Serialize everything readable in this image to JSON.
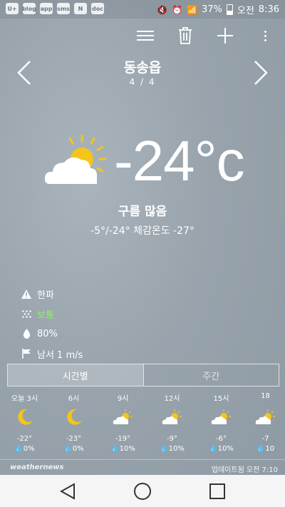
{
  "status_bar": {
    "battery": "37%",
    "ampm": "오전",
    "time": "8:36",
    "left_icons": [
      "U+",
      "blog",
      "app",
      "sms",
      "N",
      "doc"
    ]
  },
  "toolbar": {
    "icons": [
      "menu-icon",
      "trash-icon",
      "add-icon",
      "more-icon"
    ]
  },
  "location": {
    "name": "동송읍",
    "page": "4 / 4"
  },
  "current": {
    "temperature": "-24°c",
    "condition": "구름 많음",
    "range": "-5°/-24° 체감온도 -27°"
  },
  "details": {
    "warning": "한파",
    "air_quality": "보통",
    "humidity": "80%",
    "wind": "남서 1 m/s"
  },
  "tabs": {
    "hourly": "시간별",
    "weekly": "주간"
  },
  "hourly": [
    {
      "time": "오늘 3시",
      "icon": "moon",
      "temp": "-22°",
      "rain": "0%"
    },
    {
      "time": "6시",
      "icon": "moon",
      "temp": "-23°",
      "rain": "0%"
    },
    {
      "time": "9시",
      "icon": "sun-cloud",
      "temp": "-19°",
      "rain": "10%"
    },
    {
      "time": "12시",
      "icon": "sun-cloud",
      "temp": "-9°",
      "rain": "10%"
    },
    {
      "time": "15시",
      "icon": "sun-cloud",
      "temp": "-6°",
      "rain": "10%"
    },
    {
      "time": "18",
      "icon": "sun-cloud",
      "temp": "-7",
      "rain": "10"
    }
  ],
  "footer": {
    "brand": "weathernews",
    "updated": "업데이트됨 오전 7:10"
  },
  "colors": {
    "air_quality_good": "#8ef06a",
    "sun": "#f5c518"
  }
}
